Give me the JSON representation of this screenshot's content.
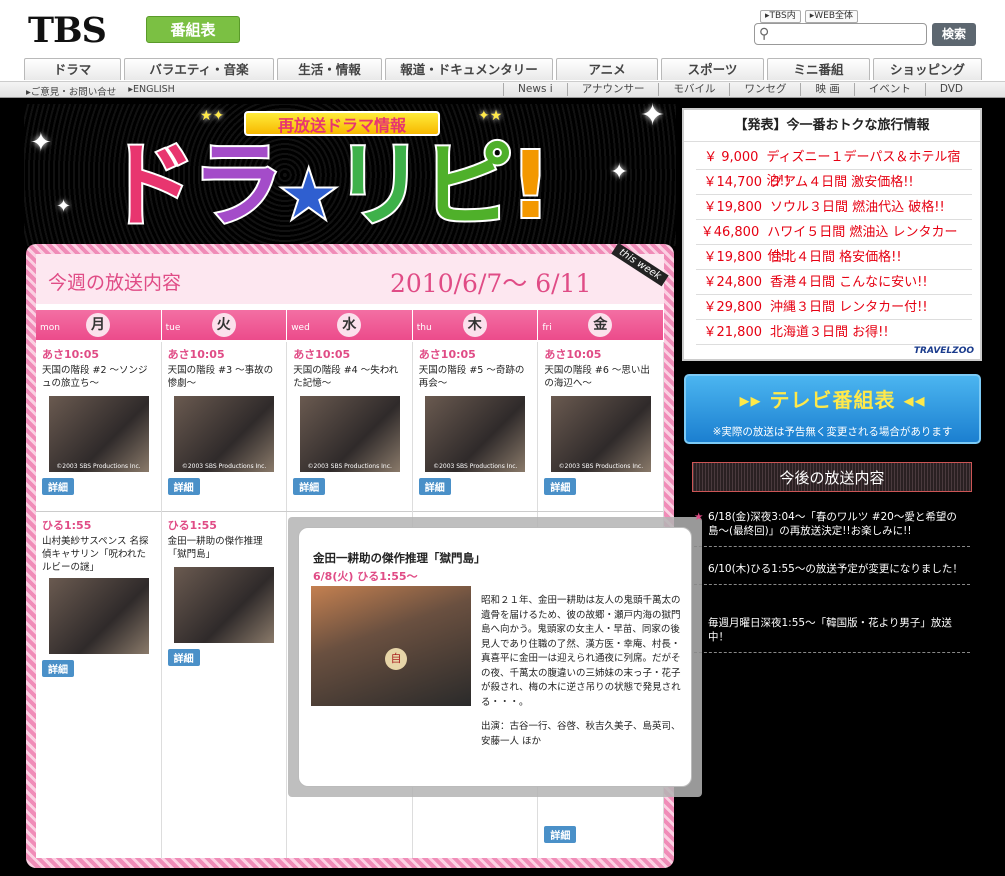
{
  "header": {
    "logo": "TBS",
    "bangumi_label": "番組表",
    "search_scope": [
      "▸TBS内",
      "▸WEB全体"
    ],
    "search_placeholder": "",
    "search_button": "検索"
  },
  "global_nav": [
    "ドラマ",
    "バラエティ・音楽",
    "生活・情報",
    "報道・ドキュメンタリー",
    "アニメ",
    "スポーツ",
    "ミニ番組",
    "ショッピング"
  ],
  "sub_nav_left": [
    "▸ご意見・お問い合せ",
    "▸ENGLISH"
  ],
  "sub_nav_right": [
    "News i",
    "アナウンサー",
    "モバイル",
    "ワンセグ",
    "映 画",
    "イベント",
    "DVD"
  ],
  "banner": {
    "subtitle": "再放送ドラマ情報",
    "title_parts": [
      "ド",
      "ラ",
      "★",
      "リ",
      "ピ",
      "!"
    ],
    "title_colors": [
      "#e8356f",
      "#a44cc9",
      "#2f5fd0",
      "#3eb14a",
      "#4fb02a",
      "#f39800"
    ]
  },
  "schedule": {
    "title": "今週の放送内容",
    "range": "2010/6/7〜 6/11",
    "this_week": "this week",
    "days": [
      {
        "en": "mon",
        "jp": "月"
      },
      {
        "en": "tue",
        "jp": "火"
      },
      {
        "en": "wed",
        "jp": "水"
      },
      {
        "en": "thu",
        "jp": "木"
      },
      {
        "en": "fri",
        "jp": "金"
      }
    ],
    "morning": [
      {
        "time": "あさ10:05",
        "desc": "天国の階段 #2 〜ソンジュの旅立ち〜",
        "copyright": "©2003 SBS Productions Inc."
      },
      {
        "time": "あさ10:05",
        "desc": "天国の階段 #3 〜事故の惨劇〜",
        "copyright": "©2003 SBS Productions Inc."
      },
      {
        "time": "あさ10:05",
        "desc": "天国の階段 #4 〜失われた記憶〜",
        "copyright": "©2003 SBS Productions Inc."
      },
      {
        "time": "あさ10:05",
        "desc": "天国の階段 #5 〜奇跡の再会〜",
        "copyright": "©2003 SBS Productions Inc."
      },
      {
        "time": "あさ10:05",
        "desc": "天国の階段 #6 〜思い出の海辺へ〜",
        "copyright": "©2003 SBS Productions Inc."
      }
    ],
    "afternoon": [
      {
        "time": "ひる1:55",
        "desc": "山村美紗サスペンス 名探偵キャサリン「呪われたルビーの謎」"
      },
      {
        "time": "ひる1:55",
        "desc": "金田一耕助の傑作推理「獄門島」"
      }
    ],
    "detail_label": "詳細"
  },
  "popup": {
    "title": "金田一耕助の傑作推理「獄門島」",
    "subtitle": "6/8(火) ひる1:55〜",
    "body": "昭和２１年、金田一耕助は友人の鬼頭千萬太の遺骨を届けるため、彼の故郷・瀬戸内海の獄門島へ向かう。鬼頭家の女主人・早苗、同家の後見人であり住職の了然、漢方医・幸庵、村長・真喜平に金田一は迎えられ通夜に列席。だがその夜、千萬太の腹違いの三姉妹の末っ子・花子が殺され、梅の木に逆さ吊りの状態で発見される・・・。",
    "cast": "出演：古谷一行、谷啓、秋吉久美子、島英司、安藤一人 ほか",
    "mark": "自"
  },
  "travel": {
    "heading": "【発表】今一番おトクな旅行情報",
    "items": [
      {
        "price": "￥ 9,000",
        "text": "ディズニー１デーパス＆ホテル宿泊!!"
      },
      {
        "price": "￥14,700",
        "text": "グアム４日間 激安価格!!"
      },
      {
        "price": "￥19,800",
        "text": "ソウル３日間 燃油代込 破格!!"
      },
      {
        "price": "￥46,800",
        "text": "ハワイ５日間 燃油込 レンタカー付!!"
      },
      {
        "price": "￥19,800",
        "text": "台北４日間 格安価格!!"
      },
      {
        "price": "￥24,800",
        "text": "香港４日間 こんなに安い!!"
      },
      {
        "price": "￥29,800",
        "text": "沖縄３日間 レンタカー付!!"
      },
      {
        "price": "￥21,800",
        "text": "北海道３日間 お得!!"
      }
    ],
    "brand": "TRAVELZOO"
  },
  "tv_button": {
    "label": "▸▸ テレビ番組表 ◂◂",
    "note": "※実際の放送は予告無く変更される場合があります"
  },
  "future": {
    "heading": "今後の放送内容",
    "items": [
      "6/18(金)深夜3:04〜「春のワルツ #20〜愛と希望の島〜(最終回)」の再放送決定!!お楽しみに!!",
      "6/10(木)ひる1:55〜の放送予定が変更になりました！",
      "毎週月曜日深夜1:55〜「韓国版・花より男子」放送中！"
    ]
  }
}
